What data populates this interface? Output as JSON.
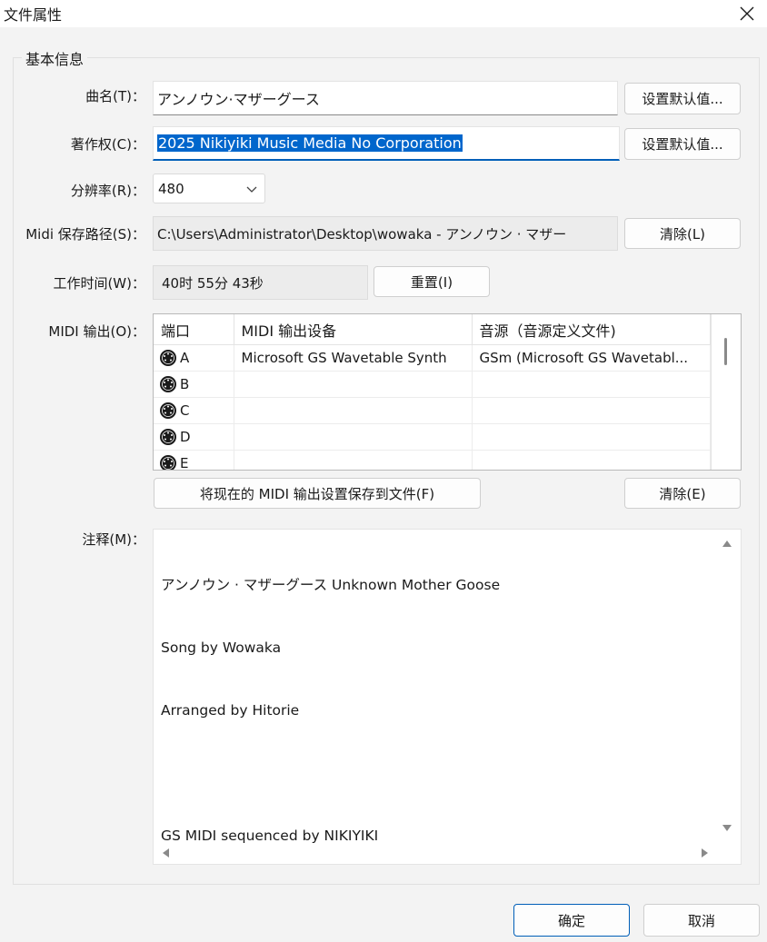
{
  "window": {
    "title": "文件属性"
  },
  "group": {
    "legend": "基本信息"
  },
  "fields": {
    "title": {
      "label": "曲名(T)：",
      "value": "アンノウン·マザーグース",
      "button": "设置默认值..."
    },
    "copyright": {
      "label": "著作权(C)：",
      "value": "2025 Nikiyiki Music Media No Corporation",
      "button": "设置默认值..."
    },
    "resolution": {
      "label": "分辨率(R)：",
      "value": "480"
    },
    "save_path": {
      "label": "Midi 保存路径(S)：",
      "value": "C:\\Users\\Administrator\\Desktop\\wowaka - アンノウン · マザー",
      "button": "清除(L)"
    },
    "work_time": {
      "label": "工作时间(W)：",
      "value": "40时 55分 43秒",
      "button": "重置(I)"
    }
  },
  "midi_output": {
    "label": "MIDI 输出(O)：",
    "columns": [
      "端口",
      "MIDI 输出设备",
      "音源（音源定义文件)"
    ],
    "rows": [
      {
        "port": "A",
        "device": "Microsoft GS Wavetable Synth",
        "source": "GSm (Microsoft GS Wavetabl..."
      },
      {
        "port": "B",
        "device": "",
        "source": ""
      },
      {
        "port": "C",
        "device": "",
        "source": ""
      },
      {
        "port": "D",
        "device": "",
        "source": ""
      },
      {
        "port": "E",
        "device": "",
        "source": ""
      }
    ],
    "save_button": "将现在的 MIDI 输出设置保存到文件(F)",
    "clear_button": "清除(E)"
  },
  "comment": {
    "label": "注释(M)：",
    "lines": [
      "アンノウン · マザーグース Unknown Mother Goose",
      "Song by Wowaka",
      "Arranged by Hitorie",
      "",
      "GS MIDI sequenced by NIKIYIKI"
    ]
  },
  "footer": {
    "ok": "确定",
    "cancel": "取消"
  },
  "colors": {
    "accent": "#005fb8",
    "selection": "#0066cc"
  }
}
